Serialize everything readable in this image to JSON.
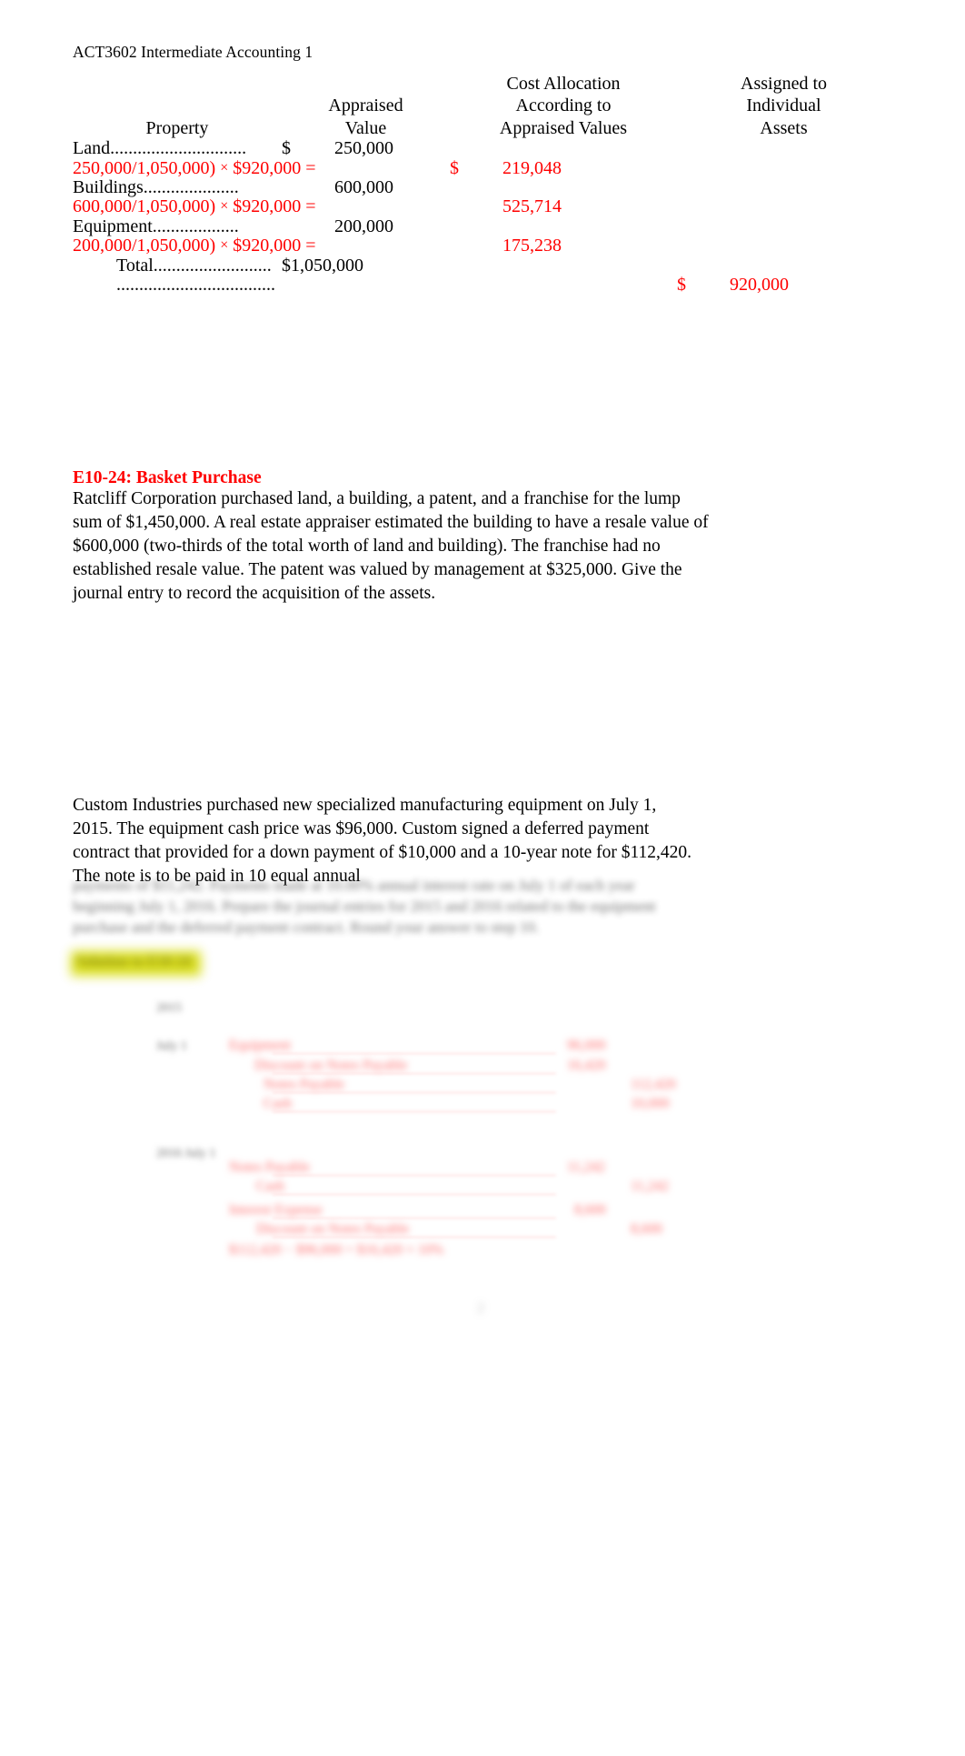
{
  "document": {
    "running_header": "ACT3602 Intermediate Accounting 1",
    "page_number": "2"
  },
  "allocation_table": {
    "headers": {
      "property": "Property",
      "appraised_value": [
        "Appraised",
        "Value"
      ],
      "cost_allocation": [
        "Cost Allocation",
        "According to",
        "Appraised Values"
      ],
      "assigned": [
        "Assigned to",
        "Individual",
        "Assets"
      ]
    },
    "rows": [
      {
        "label": "Land..............................",
        "dollar_sign": "$",
        "appraised": "250,000",
        "calc": "250,000/1,050,000)",
        "times": "×",
        "calc_rest": "$920,000 =",
        "result_sign": "$",
        "result": "219,048"
      },
      {
        "label": "Buildings.....................",
        "dollar_sign": "",
        "appraised": "600,000",
        "calc": "600,000/1,050,000)",
        "times": "×",
        "calc_rest": "$920,000 =",
        "result_sign": "",
        "result": "525,714"
      },
      {
        "label": "Equipment...................",
        "dollar_sign": "",
        "appraised": "200,000",
        "calc": "200,000/1,050,000)",
        "times": "×",
        "calc_rest": "$920,000 =",
        "result_sign": "",
        "result": "175,238"
      }
    ],
    "total_row": {
      "label": "Total..........................",
      "appraised": "$1,050,000"
    },
    "grand_total_row": {
      "label": "...................................",
      "sign": "$",
      "value": "920,000"
    }
  },
  "exercise": {
    "heading": "E10-24:  Basket Purchase",
    "body": "Ratcliff Corporation purchased land, a building, a patent, and a franchise for the lump sum of $1,450,000. A real estate appraiser estimated the building to have a resale value of $600,000 (two-thirds of the total worth of land and building). The franchise had no established resale value. The patent was valued by management at $325,000. Give the journal entry to record the acquisition of the assets."
  },
  "second_problem": {
    "body": "Custom Industries purchased new specialized manufacturing equipment on July 1, 2015. The equipment cash price was $96,000. Custom signed a deferred payment contract that provided for a down payment of $10,000 and a 10-year note for $112,420. The note is to be paid in 10 equal annual",
    "blurred_continuation": [
      "payments of $11,242. Payments made at 10.00% annual interest rate on July 1 of each year beginning July 1, 2016. Prepare the journal entries for 2015 and 2016 related to the equipment purchase and the deferred payment contract. Round your answer to step 10."
    ]
  },
  "journal_entries": {
    "highlight_label": "Solution to E10-24",
    "year_label": "2015",
    "entry_1": {
      "date": "July 1",
      "lines": [
        {
          "account": "Equipment",
          "debit": "96,000",
          "credit": ""
        },
        {
          "account": "Discount on Notes Payable",
          "debit": "16,420",
          "credit": ""
        },
        {
          "account": "Notes Payable",
          "debit": "",
          "credit": "112,420"
        },
        {
          "account": "Cash",
          "debit": "",
          "credit": "10,000"
        }
      ]
    },
    "entry_2": {
      "date": "2016 July 1",
      "lines": [
        {
          "account": "Notes Payable",
          "debit": "11,242",
          "credit": ""
        },
        {
          "account": "Cash",
          "debit": "",
          "credit": "11,242"
        },
        {
          "account": "Interest Expense",
          "debit": "8,600",
          "credit": ""
        },
        {
          "account": "Discount on Notes Payable",
          "debit": "",
          "credit": "8,600"
        }
      ],
      "note": "$112,420 − $96,000 = $16,420 × 10%"
    }
  },
  "colors": {
    "accent_red": "#FF0000",
    "text": "#000000",
    "highlight_yellow": "#D8DD12"
  }
}
